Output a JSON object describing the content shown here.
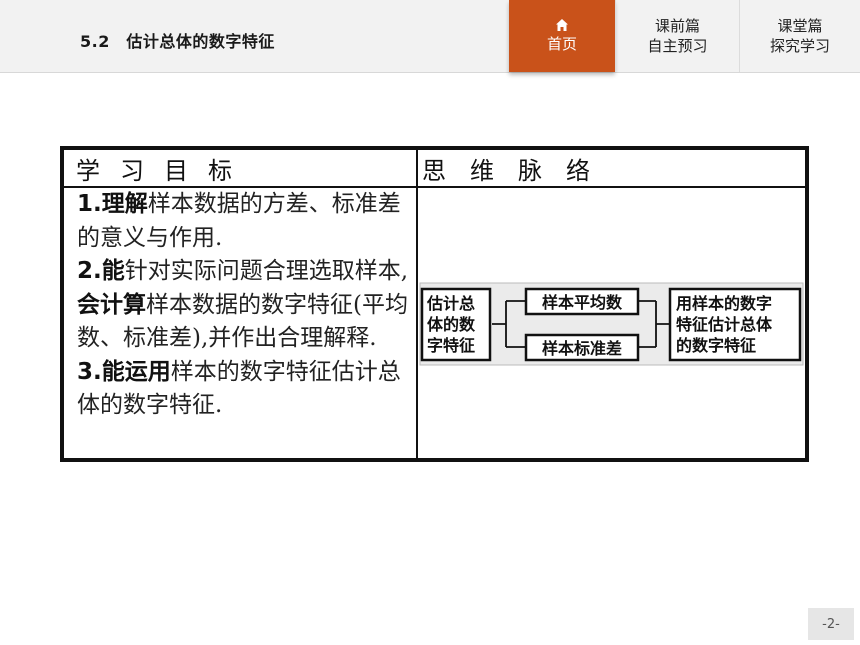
{
  "header": {
    "section_title": "5.2　估计总体的数字特征"
  },
  "nav": {
    "home_label": "首页",
    "pre_line1": "课前篇",
    "pre_line2": "自主预习",
    "class_line1": "课堂篇",
    "class_line2": "探究学习"
  },
  "table": {
    "left_header": "学习目标",
    "right_header": "思维脉络",
    "objectives": [
      {
        "num": "1",
        "verb": "理解",
        "rest": "样本数据的方差、标准差的意义与作用."
      },
      {
        "num": "2",
        "verb": "能",
        "rest": "针对实际问题合理选取样本,",
        "verb2": "会计算",
        "rest2": "样本数据的数字特征(平均数、标准差),并作出合理解释."
      },
      {
        "num": "3",
        "verb": "能运用",
        "rest": "样本的数字特征估计总体的数字特征."
      }
    ],
    "diagram": {
      "left_lines": [
        "估计总",
        "体的数",
        "字特征"
      ],
      "mid_top": "样本平均数",
      "mid_bottom": "样本标准差",
      "right_lines": [
        "用样本的数字",
        "特征估计总体",
        "的数字特征"
      ]
    }
  },
  "footer": {
    "page_number": "-2-"
  }
}
